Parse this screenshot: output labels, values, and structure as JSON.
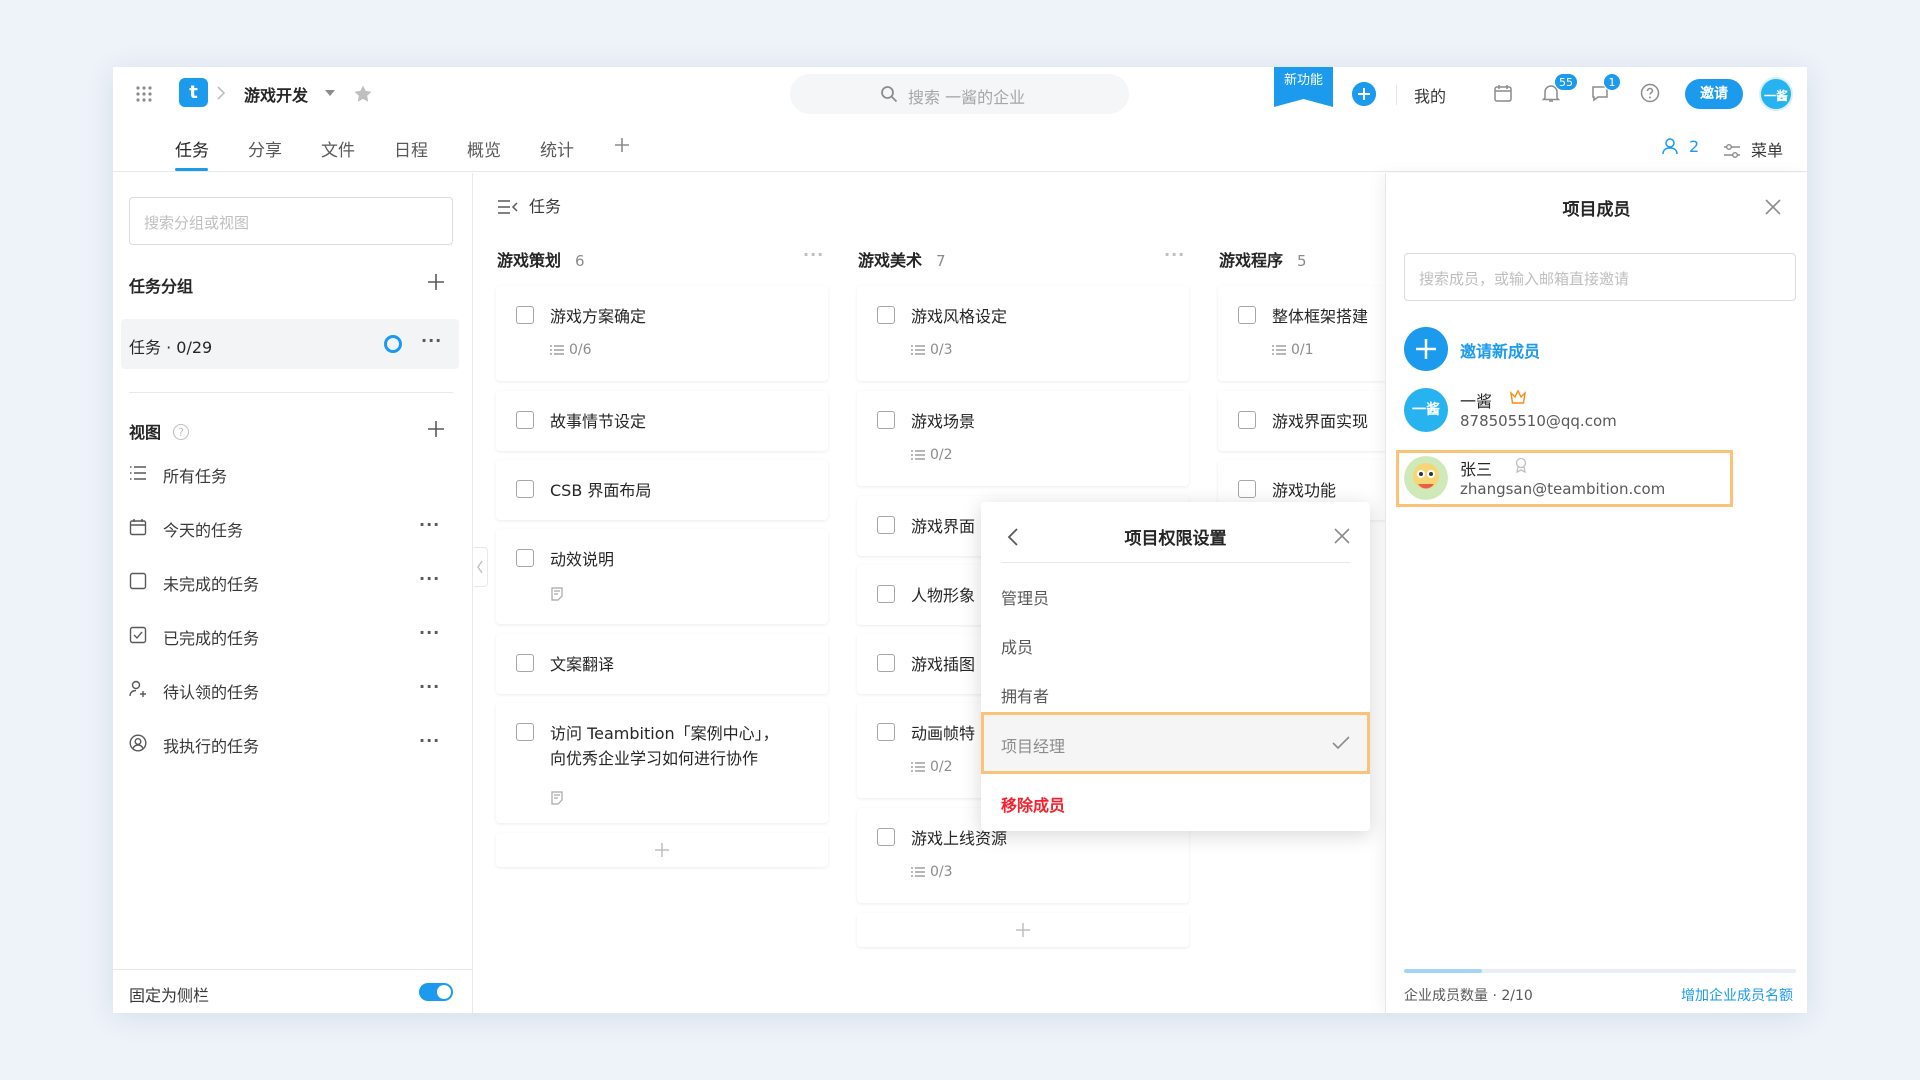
{
  "header": {
    "logo_letter": "t",
    "project_name": "游戏开发",
    "search_placeholder": "搜索 一酱的企业",
    "new_feature": "新功能",
    "mine": "我的",
    "notifications_badge": "55",
    "messages_badge": "1",
    "invite": "邀请",
    "avatar_text": "一酱"
  },
  "tabs": [
    {
      "label": "任务",
      "active": true
    },
    {
      "label": "分享"
    },
    {
      "label": "文件"
    },
    {
      "label": "日程"
    },
    {
      "label": "概览"
    },
    {
      "label": "统计"
    }
  ],
  "toolbar": {
    "member_count": "2",
    "menu": "菜单"
  },
  "sidebar": {
    "search_placeholder": "搜索分组或视图",
    "groups_title": "任务分组",
    "task_group": "任务 · 0/29",
    "views_title": "视图",
    "views": [
      {
        "label": "所有任务",
        "icon": "list-icon"
      },
      {
        "label": "今天的任务",
        "icon": "calendar-icon"
      },
      {
        "label": "未完成的任务",
        "icon": "checkbox-icon"
      },
      {
        "label": "已完成的任务",
        "icon": "checked-icon"
      },
      {
        "label": "待认领的任务",
        "icon": "user-claim-icon"
      },
      {
        "label": "我执行的任务",
        "icon": "user-circle-icon"
      }
    ],
    "pin_label": "固定为侧栏"
  },
  "board": {
    "title": "任务",
    "columns": [
      {
        "name": "游戏策划",
        "count": "6",
        "cards": [
          {
            "title": "游戏方案确定",
            "sub": "0/6"
          },
          {
            "title": "故事情节设定"
          },
          {
            "title": "CSB 界面布局"
          },
          {
            "title": "动效说明",
            "note": true
          },
          {
            "title": "文案翻译"
          },
          {
            "title": "访问 Teambition「案例中心」，",
            "title2": "向优秀企业学习如何进行协作",
            "note": true
          }
        ]
      },
      {
        "name": "游戏美术",
        "count": "7",
        "cards": [
          {
            "title": "游戏风格设定",
            "sub": "0/3"
          },
          {
            "title": "游戏场景",
            "sub": "0/2"
          },
          {
            "title": "游戏界面"
          },
          {
            "title": "人物形象"
          },
          {
            "title": "游戏插图"
          },
          {
            "title": "动画帧特",
            "sub": "0/2"
          },
          {
            "title": "游戏上线资源",
            "sub": "0/3"
          }
        ]
      },
      {
        "name": "游戏程序",
        "count": "5",
        "cards": [
          {
            "title": "整体框架搭建",
            "sub": "0/1"
          },
          {
            "title": "游戏界面实现"
          },
          {
            "title": "游戏功能"
          }
        ]
      }
    ]
  },
  "permission_menu": {
    "title": "项目权限设置",
    "options": [
      "管理员",
      "成员",
      "拥有者",
      "项目经理"
    ],
    "selected": "项目经理",
    "remove": "移除成员"
  },
  "members_panel": {
    "title": "项目成员",
    "search_placeholder": "搜索成员，或输入邮箱直接邀请",
    "invite_new": "邀请新成员",
    "members": [
      {
        "name": "一酱",
        "email": "878505510@qq.com",
        "avatar_text": "一酱",
        "role_icon": "crown-icon"
      },
      {
        "name": "张三",
        "email": "zhangsan@teambition.com",
        "role_icon": "ribbon-icon"
      }
    ],
    "quota_label": "企业成员数量 · 2/10",
    "quota_fraction": 0.2,
    "add_quota": "增加企业成员名额"
  },
  "colors": {
    "accent": "#1b9aee",
    "highlight": "#fbc27a",
    "danger": "#f5222d"
  }
}
